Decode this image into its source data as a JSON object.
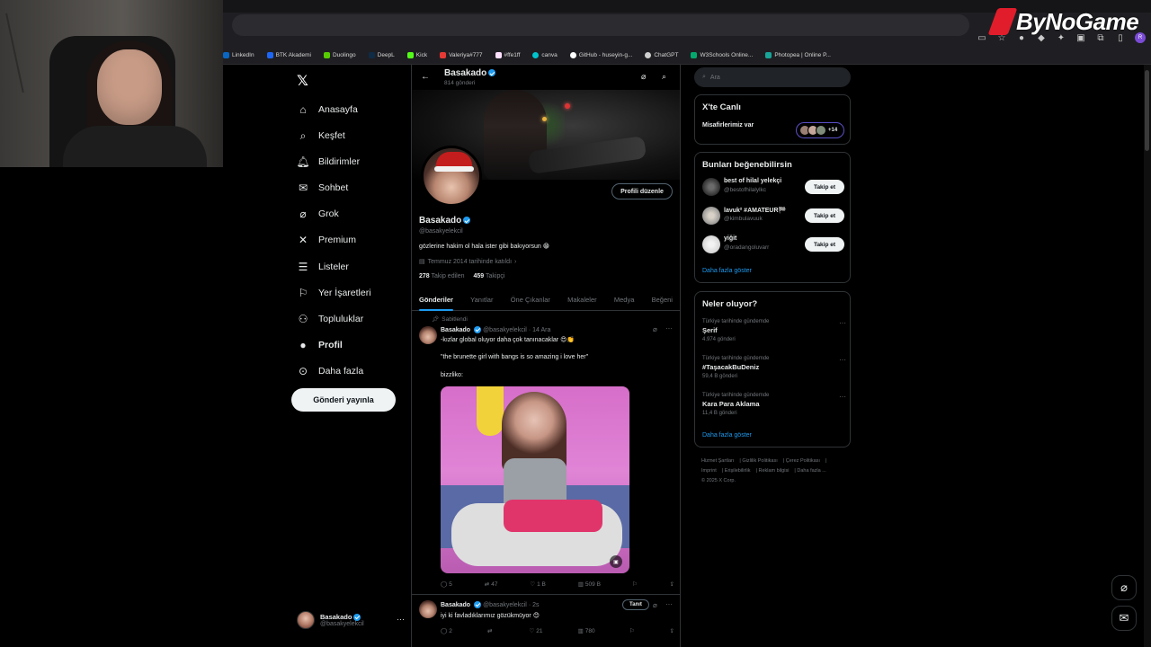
{
  "logo": {
    "text": "ByNoGame"
  },
  "bookmarks": [
    "LinkedIn",
    "BTK Akademi",
    "Duolingo",
    "DeepL",
    "Kick",
    "Valeriya#777",
    "#ffe1ff",
    "canva",
    "GitHub - huseyin-g...",
    "ChatGPT",
    "W3Schools Online...",
    "Photopea | Online P..."
  ],
  "nav": {
    "items": [
      {
        "label": "Anasayfa",
        "icon": "home-icon"
      },
      {
        "label": "Keşfet",
        "icon": "search-icon"
      },
      {
        "label": "Bildirimler",
        "icon": "bell-icon"
      },
      {
        "label": "Sohbet",
        "icon": "mail-icon"
      },
      {
        "label": "Grok",
        "icon": "grok-icon"
      },
      {
        "label": "Premium",
        "icon": "x-icon"
      },
      {
        "label": "Listeler",
        "icon": "list-icon"
      },
      {
        "label": "Yer İşaretleri",
        "icon": "bookmark-icon"
      },
      {
        "label": "Topluluklar",
        "icon": "people-icon"
      },
      {
        "label": "Profil",
        "icon": "person-icon"
      },
      {
        "label": "Daha fazla",
        "icon": "more-circle-icon"
      }
    ],
    "post_button": "Gönderi yayınla",
    "account": {
      "name": "Basakado",
      "handle": "@basakyelekcil"
    }
  },
  "profile": {
    "name": "Basakado",
    "post_count": "814 gönderi",
    "handle": "@basakyelekcil",
    "bio": "gözlerine hakim ol hala ister gibi bakıyorsun 😁",
    "joined": "Temmuz 2014 tarihinde katıldı",
    "following_num": "278",
    "following_label": "Takip edilen",
    "followers_num": "459",
    "followers_label": "Takipçi",
    "edit_button": "Profili düzenle"
  },
  "tabs": [
    "Gönderiler",
    "Yanıtlar",
    "Öne Çıkanlar",
    "Makaleler",
    "Medya",
    "Beğeni"
  ],
  "tweets": [
    {
      "pinned_label": "Sabitlendi",
      "name": "Basakado",
      "handle": "@basakyelekcil",
      "time": "· 14 Ara",
      "line1": "-kızlar global oluyor daha çok tanınacaklar 😍👏",
      "line2": "\"the brunette girl with bangs is so amazing i love her\"",
      "line3": "bizzliko:",
      "replies": "5",
      "retweets": "47",
      "likes": "1 B",
      "views": "509 B"
    },
    {
      "name": "Basakado",
      "handle": "@basakyelekcil",
      "time": "· 2s",
      "promote": "Tanıt",
      "line1": "iyi ki favladıklarımız gözükmüyor 😊",
      "replies": "2",
      "retweets": "",
      "likes": "21",
      "views": "780"
    }
  ],
  "right": {
    "search_placeholder": "Ara",
    "live": {
      "title": "X'te Canlı",
      "row": "Misafirlerimiz var",
      "plus": "+14"
    },
    "who": {
      "title": "Bunları beğenebilirsin",
      "items": [
        {
          "name": "best of hilal yelekçi",
          "handle": "@bestofhilalylkc",
          "button": "Takip et"
        },
        {
          "name": "lavuk² #AMATEUR🏁",
          "handle": "@kimbulavuuk",
          "button": "Takip et"
        },
        {
          "name": "yiğit",
          "handle": "@oradangoluvarr",
          "button": "Takip et"
        }
      ],
      "show_more": "Daha fazla göster"
    },
    "trends": {
      "title": "Neler oluyor?",
      "items": [
        {
          "context": "Türkiye tarihinde gündemde",
          "topic": "Şerif",
          "count": "4.974 gönderi"
        },
        {
          "context": "Türkiye tarihinde gündemde",
          "topic": "#TaşacakBuDeniz",
          "count": "59,4 B gönderi"
        },
        {
          "context": "Türkiye tarihinde gündemde",
          "topic": "Kara Para Aklama",
          "count": "11,4 B gönderi"
        }
      ],
      "show_more": "Daha fazla göster"
    },
    "footer": [
      "Hizmet Şartları",
      "Gizlilik Politikası",
      "Çerez Politikası",
      "Imprint",
      "Erişilebilirlik",
      "Reklam bilgisi",
      "Daha fazla ...",
      "© 2025 X Corp."
    ]
  }
}
